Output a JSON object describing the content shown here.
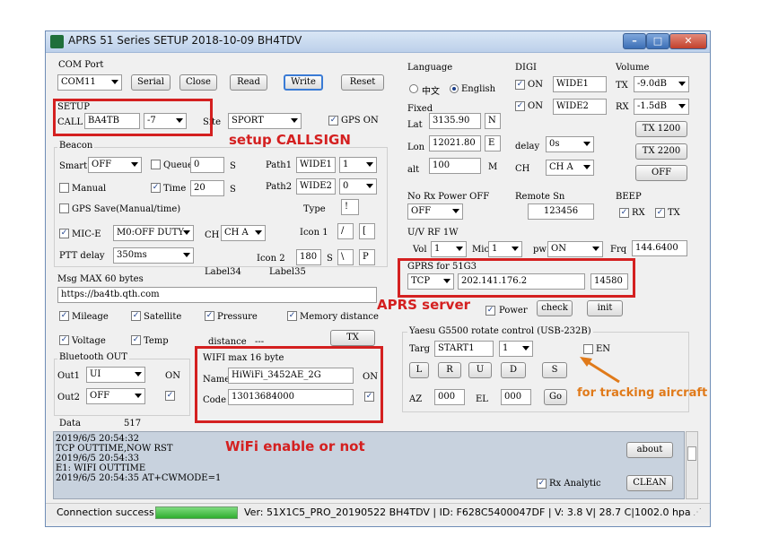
{
  "window": {
    "title": "APRS  51 Series SETUP 2018-10-09 BH4TDV"
  },
  "com_port": {
    "label": "COM Port",
    "port": "COM11",
    "serial": "Serial",
    "close": "Close",
    "read": "Read",
    "write": "Write",
    "reset": "Reset"
  },
  "setup": {
    "label": "SETUP",
    "call_label": "CALL",
    "call": "BA4TB",
    "ssid": "-7",
    "site_label": "Site",
    "site": "SPORT",
    "gps_on": "GPS ON"
  },
  "beacon": {
    "label": "Beacon",
    "smart_label": "Smart",
    "smart": "OFF",
    "queue_label": "Queue",
    "queue": "0",
    "s1": "S",
    "path1_label": "Path1",
    "path1": "WIDE1",
    "path1_n": "1",
    "manual": "Manual",
    "time_label": "Time",
    "time": "20",
    "s2": "S",
    "path2_label": "Path2",
    "path2": "WIDE2",
    "path2_n": "0",
    "gps_save": "GPS Save(Manual/time)",
    "type_label": "Type",
    "type": "!",
    "mic_e": "MIC-E",
    "mic_e_mode": "M0:OFF DUTY",
    "ch_label": "CH",
    "ch": "CH A",
    "icon1_label": "Icon 1",
    "icon1_a": "/",
    "icon1_b": "[",
    "ptt_label": "PTT delay",
    "ptt": "350ms",
    "icon2_label": "Icon 2",
    "icon2_n": "180",
    "icon2_a": "S",
    "icon2_b": "P",
    "label34": "Label34",
    "label35": "Label35"
  },
  "msg": {
    "label": "Msg MAX 60 bytes",
    "text": "https://ba4tb.qth.com"
  },
  "options": {
    "mileage": "Mileage",
    "satellite": "Satellite",
    "pressure": "Pressure",
    "memory_distance": "Memory distance",
    "voltage": "Voltage",
    "temp": "Temp",
    "distance": "distance",
    "distance_val": "---",
    "tx": "TX"
  },
  "bluetooth": {
    "label": "Bluetooth OUT",
    "out1_label": "Out1",
    "out1": "UI",
    "on": "ON",
    "out2_label": "Out2",
    "out2": "OFF"
  },
  "wifi": {
    "label": "WIFI max 16 byte",
    "name_label": "Name",
    "name": "HiWiFi_3452AE_2G",
    "on": "ON",
    "code_label": "Code",
    "code": "13013684000"
  },
  "language": {
    "label": "Language",
    "chinese": "中文",
    "english": "English"
  },
  "fixed": {
    "label": "Fixed",
    "lat_label": "Lat",
    "lat": "3135.90",
    "lat_dir": "N",
    "lon_label": "Lon",
    "lon": "12021.80",
    "lon_dir": "E",
    "alt_label": "alt",
    "alt": "100",
    "alt_unit": "M"
  },
  "digi": {
    "label": "DIGI",
    "on1": "ON",
    "wide1": "WIDE1",
    "on2": "ON",
    "wide2": "WIDE2",
    "delay_label": "delay",
    "delay": "0s",
    "ch_label": "CH",
    "ch": "CH A"
  },
  "volume": {
    "label": "Volume",
    "tx_label": "TX",
    "tx": "-9.0dB",
    "rx_label": "RX",
    "rx": "-1.5dB",
    "tx1200": "TX 1200",
    "tx2200": "TX 2200",
    "off": "OFF"
  },
  "no_rx": {
    "label": "No Rx Power OFF",
    "value": "OFF"
  },
  "remote": {
    "label": "Remote Sn",
    "value": "123456"
  },
  "beep": {
    "label": "BEEP",
    "rx": "RX",
    "tx": "TX"
  },
  "uv_rf": {
    "label": "U/V RF 1W",
    "vol_label": "Vol",
    "vol": "1",
    "mic_label": "Mic",
    "mic": "1",
    "pw_label": "pw",
    "pw": "ON",
    "frq_label": "Frq",
    "frq": "144.6400"
  },
  "gprs": {
    "label": "GPRS for 51G3",
    "proto": "TCP",
    "ip": "202.141.176.2",
    "port": "14580",
    "power": "Power",
    "check": "check",
    "init": "init"
  },
  "rotate": {
    "label": "Yaesu G5500 rotate control  (USB-232B)",
    "targ_label": "Targ",
    "targ": "START1",
    "targ_n": "1",
    "en": "EN",
    "b_l": "L",
    "b_r": "R",
    "b_u": "U",
    "b_d": "D",
    "b_s": "S",
    "az_label": "AZ",
    "az": "000",
    "el_label": "EL",
    "el": "000",
    "go": "Go"
  },
  "data_row": {
    "label": "Data",
    "value": "517"
  },
  "log": {
    "lines": [
      "2019/6/5 20:54:32",
      "TCP OUTTIME,NOW RST",
      "2019/6/5 20:54:33",
      " E1: WIFI OUTTIME",
      "2019/6/5 20:54:35  AT+CWMODE=1"
    ],
    "about": "about",
    "rx_analytic": "Rx Analytic",
    "clean": "CLEAN"
  },
  "status": {
    "connection": "Connection success",
    "version": "Ver: 51X1C5_PRO_20190522 BH4TDV | ID: F628C5400047DF | V: 3.8 V|  28.7 C|1002.0 hpa"
  },
  "annotations": {
    "setup_callsign": "setup CALLSIGN",
    "aprs_server": "APRS server",
    "tracking": "for tracking aircraft",
    "wifi": "WiFi enable or not"
  },
  "colors": {
    "annotation": "#d42020",
    "annotation_arrow": "#e07a1a",
    "log_bg": "#c8d2de",
    "progress": "#2fae2f"
  }
}
